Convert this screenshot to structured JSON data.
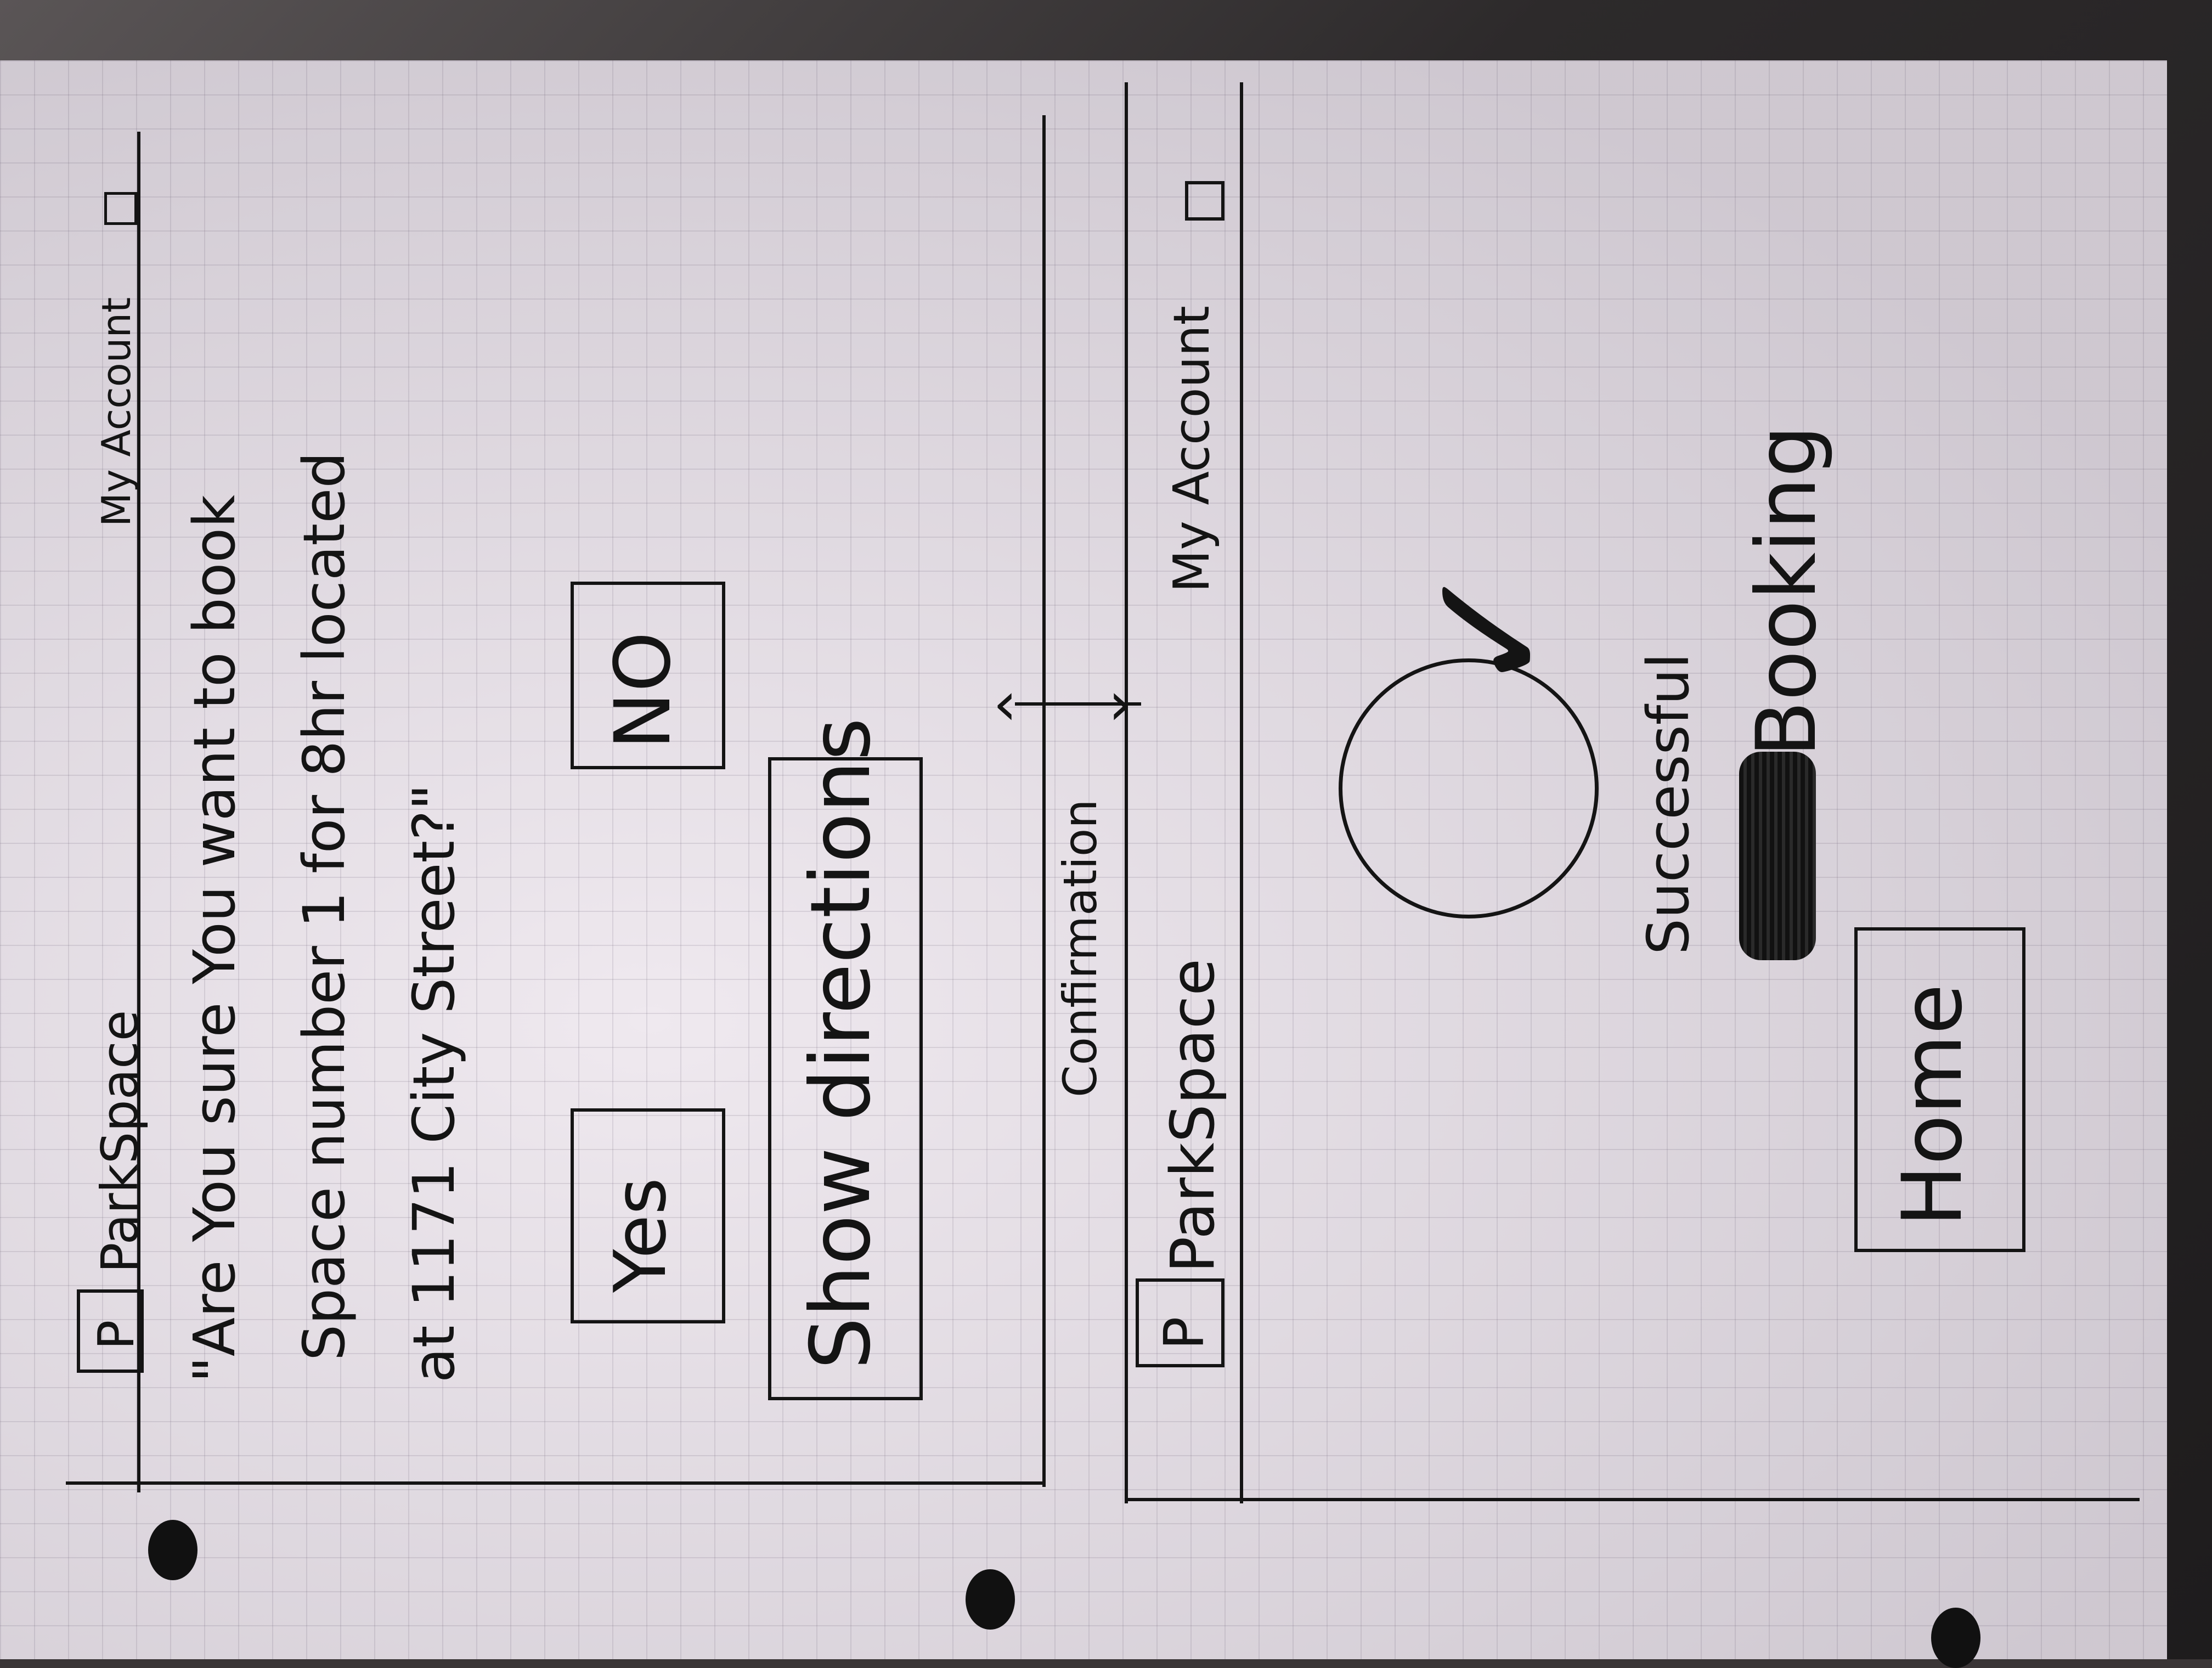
{
  "screen1": {
    "logo_letter": "P",
    "brand": "ParkSpace",
    "account_label": "My Account",
    "question": {
      "line1": "\"Are You sure You want to book",
      "line2": "Space number 1 for 8hr located",
      "line3": "at 1171 City Street?\""
    },
    "yes_label": "Yes",
    "no_label": "NO",
    "directions_label": "Show directions"
  },
  "transition_label": "Confirmation",
  "screen2": {
    "logo_letter": "P",
    "brand": "ParkSpace",
    "account_label": "My Account",
    "success_label": "Successful",
    "booking_label": "Booking",
    "home_label": "Home"
  }
}
